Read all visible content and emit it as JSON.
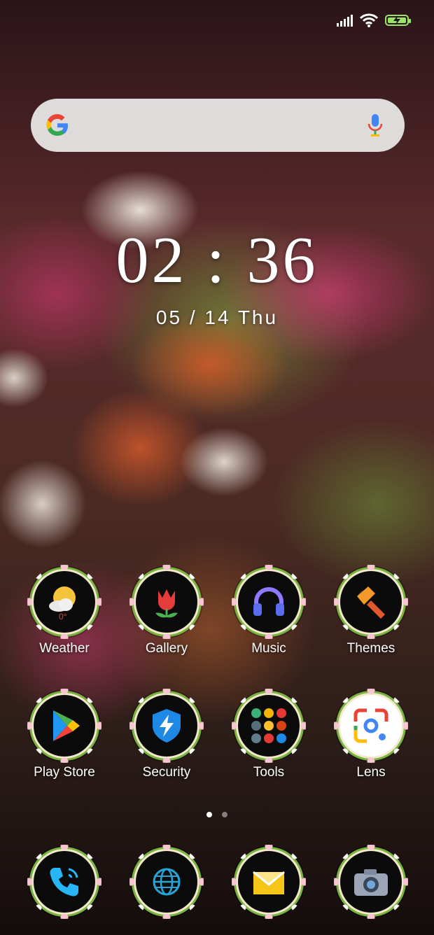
{
  "status_bar": {
    "signal_icon": "cellular-signal-icon",
    "wifi_icon": "wifi-icon",
    "battery_icon": "battery-charging-icon",
    "battery_color": "#9be36a"
  },
  "search": {
    "logo_icon": "google-g-icon",
    "mic_icon": "microphone-icon"
  },
  "clock": {
    "time": "02 : 36",
    "date": "05 / 14  Thu"
  },
  "apps": [
    {
      "label": "Weather",
      "icon": "weather-icon",
      "temp": "0°"
    },
    {
      "label": "Gallery",
      "icon": "tulip-icon"
    },
    {
      "label": "Music",
      "icon": "headphones-icon"
    },
    {
      "label": "Themes",
      "icon": "paintbrush-icon"
    },
    {
      "label": "Play Store",
      "icon": "play-store-icon"
    },
    {
      "label": "Security",
      "icon": "shield-bolt-icon"
    },
    {
      "label": "Tools",
      "icon": "folder-icon"
    },
    {
      "label": "Lens",
      "icon": "lens-icon"
    }
  ],
  "dock": [
    {
      "icon": "phone-icon"
    },
    {
      "icon": "globe-browser-icon"
    },
    {
      "icon": "envelope-icon"
    },
    {
      "icon": "camera-icon"
    }
  ],
  "page_indicator": {
    "pages": 2,
    "current": 1
  }
}
